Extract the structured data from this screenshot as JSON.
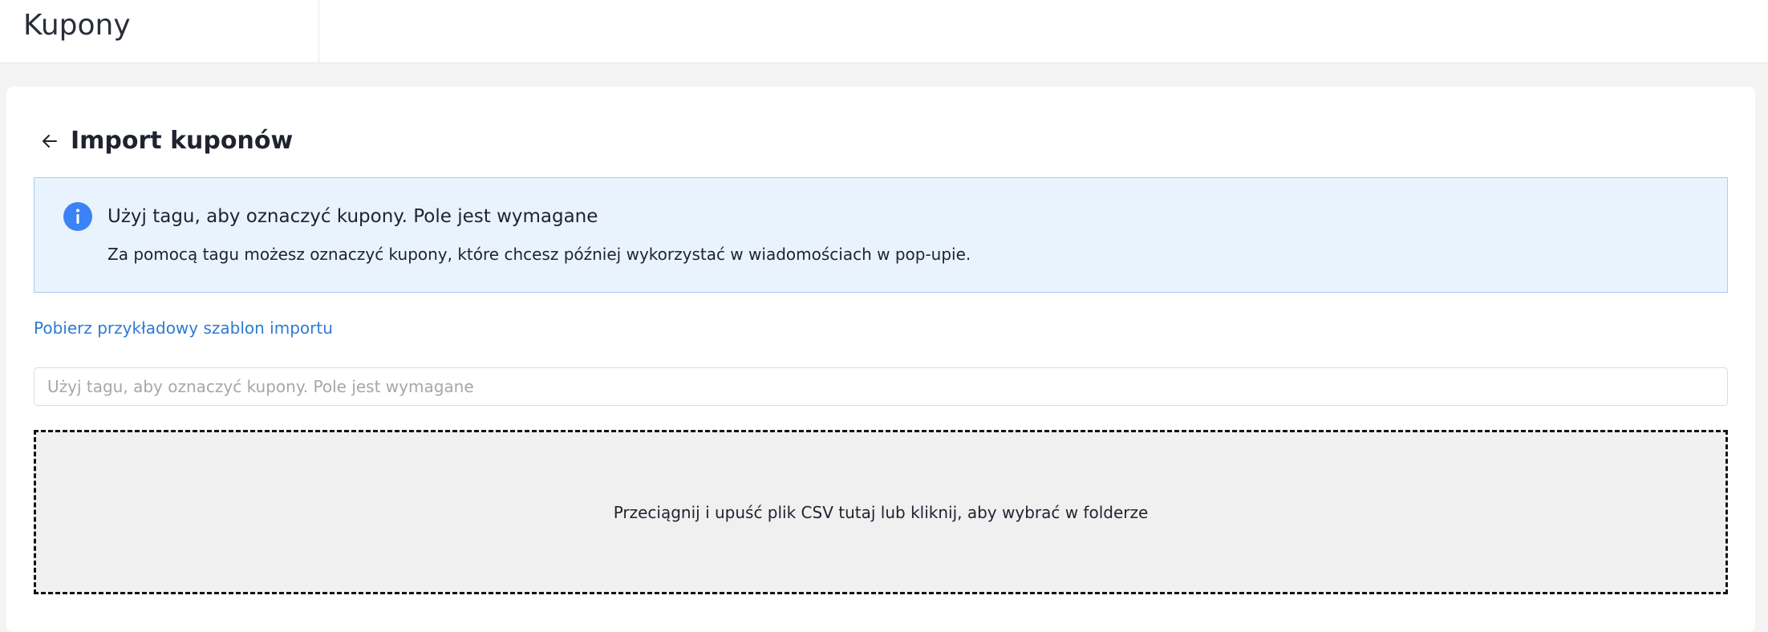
{
  "header": {
    "title": "Kupony"
  },
  "page": {
    "title": "Import kuponów",
    "back_icon": "arrow-left-icon"
  },
  "info": {
    "icon": "info-icon",
    "title": "Użyj tagu, aby oznaczyć kupony. Pole jest wymagane",
    "text": "Za pomocą tagu możesz oznaczyć kupony, które chcesz później wykorzystać w wiadomościach w pop-upie."
  },
  "template_link": {
    "label": "Pobierz przykładowy szablon importu"
  },
  "tag_input": {
    "value": "",
    "placeholder": "Użyj tagu, aby oznaczyć kupony. Pole jest wymagane"
  },
  "dropzone": {
    "label": "Przeciągnij i upuść plik CSV tutaj lub kliknij, aby wybrać w folderze"
  },
  "colors": {
    "accent": "#3b82f6",
    "link": "#2d7bd4",
    "info_background": "#e9f3fd",
    "info_border": "#a9cdf2",
    "dropzone_background": "#f0f0f0"
  }
}
